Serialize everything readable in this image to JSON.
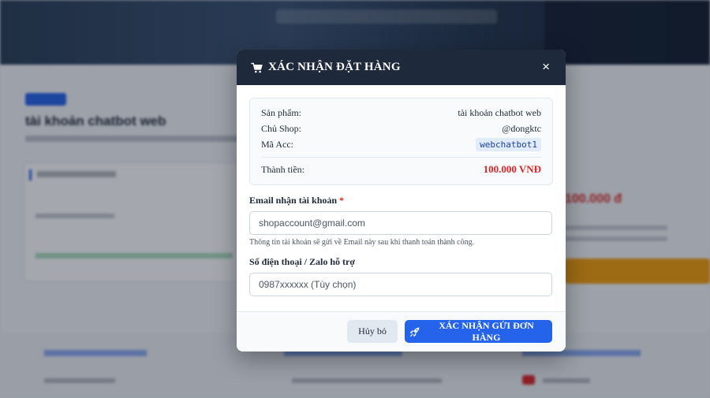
{
  "background": {
    "product_title": "tài khoản chatbot web",
    "price": "100.000 đ"
  },
  "modal": {
    "title": "XÁC NHẬN ĐẶT HÀNG",
    "title_icon": "cart-icon",
    "close_label": "×",
    "summary": {
      "product_label": "Sản phẩm:",
      "product_value": "tài khoản chatbot web",
      "shop_label": "Chủ Shop:",
      "shop_value": "@dongktc",
      "acc_label": "Mã Acc:",
      "acc_value": "webchatbot1",
      "total_label": "Thành tiền:",
      "total_value": "100.000 VNĐ"
    },
    "email": {
      "label": "Email nhận tài khoản",
      "required_mark": "*",
      "placeholder": "shopaccount@gmail.com",
      "value": "",
      "hint": "Thông tin tài khoản sẽ gửi về Email này sau khi thanh toán thành công."
    },
    "phone": {
      "label": "Số điện thoại / Zalo hỗ trợ",
      "placeholder": "0987xxxxxx (Tùy chọn)",
      "value": ""
    },
    "buttons": {
      "cancel": "Hủy bỏ",
      "confirm": "XÁC NHẬN GỬI ĐƠN HÀNG",
      "confirm_icon": "rocket-icon"
    }
  },
  "colors": {
    "header": "#1e293b",
    "accent": "#2563eb",
    "price": "#dc2626"
  }
}
